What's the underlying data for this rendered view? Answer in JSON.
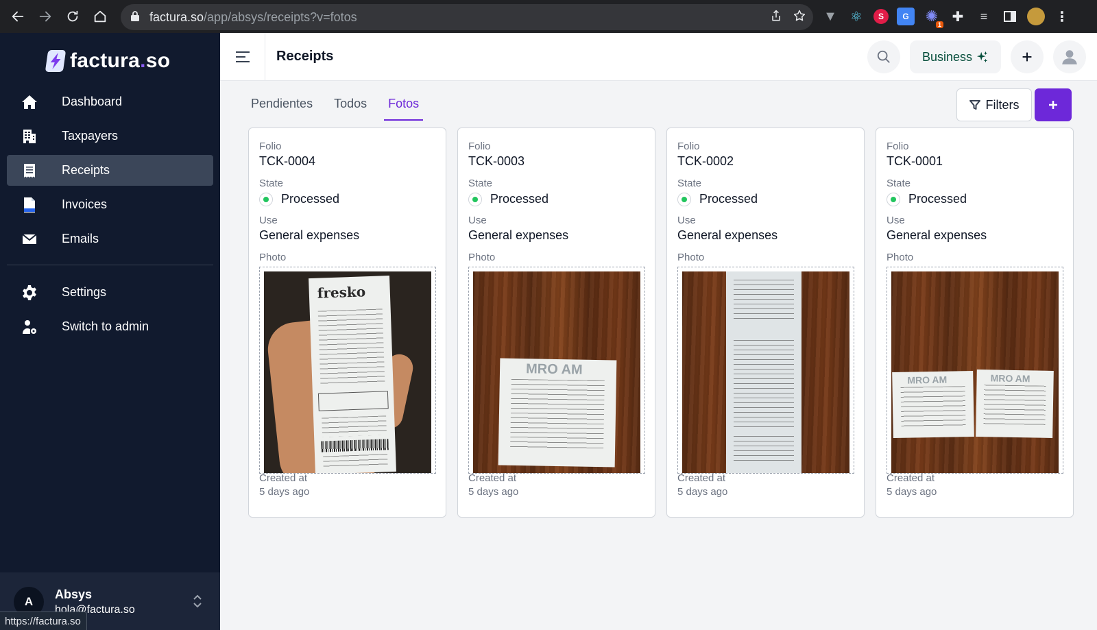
{
  "browser": {
    "url_host": "factura.so",
    "url_path": "/app/absys/receipts?v=fotos",
    "status_url": "https://factura.so"
  },
  "brand": {
    "name_main": "factura",
    "name_dot": ".",
    "name_tail": "so"
  },
  "sidebar": {
    "items": [
      {
        "label": "Dashboard",
        "icon": "home-icon"
      },
      {
        "label": "Taxpayers",
        "icon": "building-icon"
      },
      {
        "label": "Receipts",
        "icon": "receipt-icon",
        "active": true
      },
      {
        "label": "Invoices",
        "icon": "xml-file-icon"
      },
      {
        "label": "Emails",
        "icon": "envelope-icon"
      }
    ],
    "secondary": [
      {
        "label": "Settings",
        "icon": "gear-icon"
      },
      {
        "label": "Switch to admin",
        "icon": "user-cog-icon"
      }
    ],
    "user": {
      "initial": "A",
      "name": "Absys",
      "email": "hola@factura.so"
    }
  },
  "header": {
    "title": "Receipts",
    "plan_label": "Business"
  },
  "tabs": [
    {
      "label": "Pendientes",
      "active": false
    },
    {
      "label": "Todos",
      "active": false
    },
    {
      "label": "Fotos",
      "active": true
    }
  ],
  "toolbar": {
    "filters_label": "Filters",
    "add_label": "+"
  },
  "labels": {
    "folio": "Folio",
    "state": "State",
    "use": "Use",
    "photo": "Photo",
    "created": "Created at"
  },
  "receipts": [
    {
      "folio": "TCK-0004",
      "state": "Processed",
      "use": "General expenses",
      "created": "5 days ago",
      "photo_text": "fresko"
    },
    {
      "folio": "TCK-0003",
      "state": "Processed",
      "use": "General expenses",
      "created": "5 days ago",
      "photo_text": "MRO AM"
    },
    {
      "folio": "TCK-0002",
      "state": "Processed",
      "use": "General expenses",
      "created": "5 days ago",
      "photo_text": ""
    },
    {
      "folio": "TCK-0001",
      "state": "Processed",
      "use": "General expenses",
      "created": "5 days ago",
      "photo_text": "MRO AM"
    }
  ],
  "colors": {
    "accent": "#6d28d9",
    "sidebar_bg": "#111a2e",
    "status_ok": "#22c55e"
  }
}
